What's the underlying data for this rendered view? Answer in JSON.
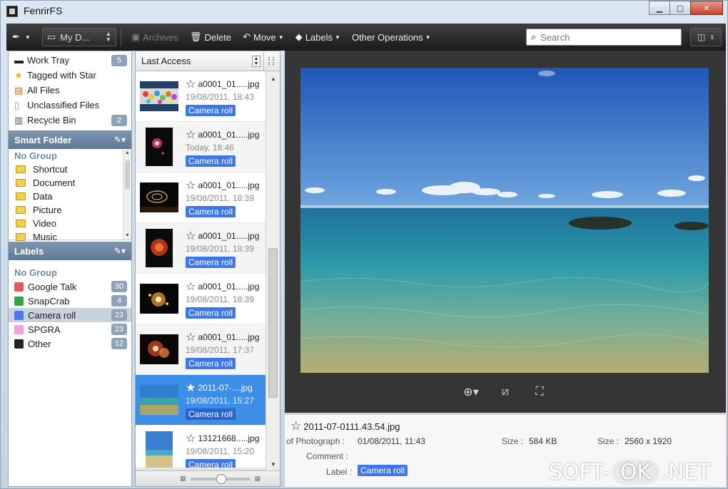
{
  "window": {
    "title": "FenrirFS"
  },
  "toolbar": {
    "drive_label": "My D...",
    "archives_label": "Archives",
    "delete_label": "Delete",
    "move_label": "Move",
    "labels_label": "Labels",
    "other_label": "Other Operations",
    "search_placeholder": "Search"
  },
  "sidebar": {
    "nav": [
      {
        "label": "Work Tray",
        "count": "5"
      },
      {
        "label": "Tagged with Star",
        "count": ""
      },
      {
        "label": "All Files",
        "count": ""
      },
      {
        "label": "Unclassified Files",
        "count": ""
      },
      {
        "label": "Recycle Bin",
        "count": "2"
      }
    ],
    "smart_folder_title": "Smart Folder",
    "smart_group": "No Group",
    "folders": [
      "Shortcut",
      "Document",
      "Data",
      "Picture",
      "Video",
      "Music"
    ],
    "labels_title": "Labels",
    "labels_group": "No Group",
    "labels": [
      {
        "label": "Google Talk",
        "count": "30",
        "color": "#e05a5a"
      },
      {
        "label": "SnapCrab",
        "count": "4",
        "color": "#3aa04a"
      },
      {
        "label": "Camera roll",
        "count": "23",
        "color": "#4a78e6"
      },
      {
        "label": "SPGRA",
        "count": "23",
        "color": "#f2a0d8"
      },
      {
        "label": "Other",
        "count": "12",
        "color": "#222222"
      }
    ]
  },
  "list": {
    "sort_label": "Last Access",
    "files": [
      {
        "name": "a0001_01.....jpg",
        "date": "19/08/2011, 18:43",
        "tag": "Camera roll"
      },
      {
        "name": "a0001_01.....jpg",
        "date": "Today, 18:46",
        "tag": "Camera roll"
      },
      {
        "name": "a0001_01.....jpg",
        "date": "19/08/2011, 18:39",
        "tag": "Camera roll"
      },
      {
        "name": "a0001_01.....jpg",
        "date": "19/08/2011, 18:39",
        "tag": "Camera roll"
      },
      {
        "name": "a0001_01.....jpg",
        "date": "19/08/2011, 18:39",
        "tag": "Camera roll"
      },
      {
        "name": "a0001_01.....jpg",
        "date": "19/08/2011, 17:37",
        "tag": "Camera roll"
      },
      {
        "name": "2011-07-....jpg",
        "date": "19/08/2011, 15:27",
        "tag": "Camera roll"
      },
      {
        "name": "13121668.....jpg",
        "date": "19/08/2011, 15:20",
        "tag": "Camera roll"
      }
    ]
  },
  "info": {
    "file_name": "2011-07-0111.43.54.jpg",
    "date_label": "of Photograph :",
    "date_value": "01/08/2011, 11:43",
    "size_label": "Size :",
    "size_value": "584 KB",
    "dim_label": "Size :",
    "dim_value": "2560 x 1920",
    "comment_label": "Comment :",
    "label_label": "Label :",
    "label_value": "Camera roll"
  },
  "watermark": {
    "left": "SOFT-",
    "mid": "OK",
    "right": ".NET"
  }
}
